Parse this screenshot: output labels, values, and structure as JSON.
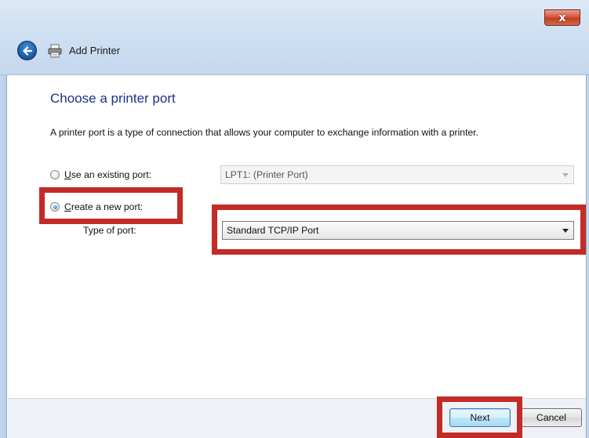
{
  "window": {
    "title": "Add Printer",
    "close_glyph": "x",
    "back_icon": "back-arrow-icon",
    "title_icon": "printer-icon"
  },
  "page": {
    "heading": "Choose a printer port",
    "description": "A printer port is a type of connection that allows your computer to exchange information with a printer."
  },
  "options": {
    "existing_port": {
      "label_prefix": "",
      "label_accel": "U",
      "label_rest": "se an existing port:",
      "selected": false,
      "value": "LPT1: (Printer Port)",
      "enabled": false
    },
    "new_port": {
      "label_accel": "C",
      "label_rest": "reate a new port:",
      "selected": true
    },
    "type_of_port": {
      "label": "Type of port:",
      "value": "Standard TCP/IP Port"
    }
  },
  "buttons": {
    "next": "Next",
    "cancel": "Cancel"
  },
  "colors": {
    "highlight": "#c42a26",
    "heading": "#1e3287"
  }
}
